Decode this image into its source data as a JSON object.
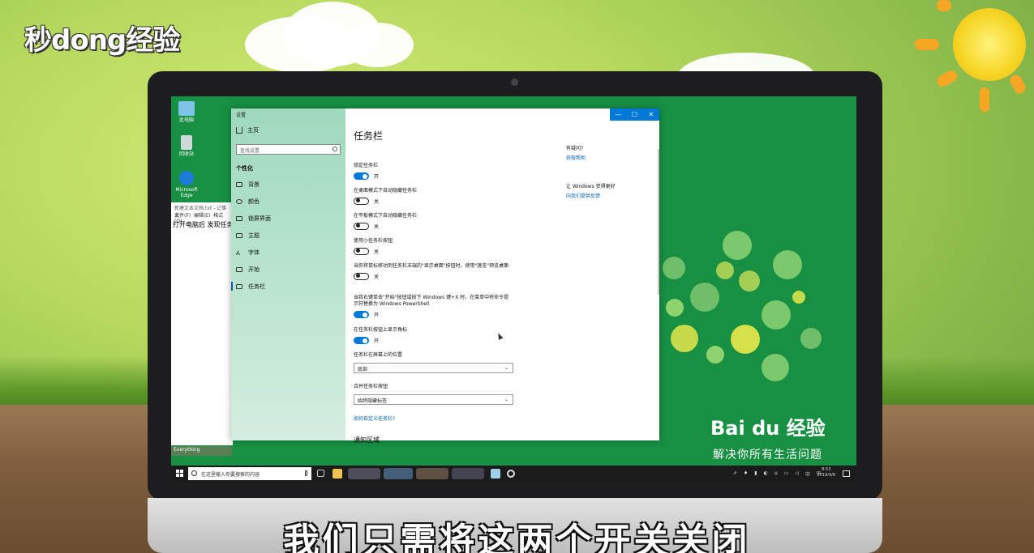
{
  "overlay": {
    "site_logo": "秒dong经验",
    "subtitle": "我们只需将这两个开关关闭"
  },
  "desktop": {
    "icons": [
      {
        "label": "此电脑",
        "icon": "computer-icon"
      },
      {
        "label": "回收站",
        "icon": "recycle-bin-icon"
      },
      {
        "label": "Microsoft Edge",
        "icon": "edge-icon"
      }
    ],
    "notepad": {
      "title": "新建文本文档.txt - 记事本",
      "menu": [
        "文件(F)",
        "编辑(E)",
        "格式(O)"
      ],
      "body": "打开电脑后 发现任务栏"
    },
    "everything_label": "Everything",
    "branding": {
      "logo": "Bai du 经验",
      "slogan": "解决你所有生活问题"
    }
  },
  "settings": {
    "window_title": "设置",
    "controls": {
      "minimize": "—",
      "maximize": "☐",
      "close": "✕"
    },
    "sidebar": {
      "home": "主页",
      "search_placeholder": "查找设置",
      "section": "个性化",
      "items": [
        {
          "label": "背景",
          "icon": "image-icon"
        },
        {
          "label": "颜色",
          "icon": "palette-icon"
        },
        {
          "label": "锁屏界面",
          "icon": "lock-screen-icon"
        },
        {
          "label": "主题",
          "icon": "theme-icon"
        },
        {
          "label": "字体",
          "icon": "font-icon"
        },
        {
          "label": "开始",
          "icon": "start-icon"
        },
        {
          "label": "任务栏",
          "icon": "taskbar-icon",
          "active": true
        }
      ]
    },
    "page_title": "任务栏",
    "toggles": [
      {
        "label": "锁定任务栏",
        "state": "开",
        "on": true
      },
      {
        "label": "在桌面模式下自动隐藏任务栏",
        "state": "关",
        "on": false
      },
      {
        "label": "在平板模式下自动隐藏任务栏",
        "state": "关",
        "on": false
      },
      {
        "label": "使用小任务栏按钮",
        "state": "关",
        "on": false
      },
      {
        "label": "当你将鼠标移动到任务栏末端的\"显示桌面\"按钮时，使用\"速览\"预览桌面",
        "state": "关",
        "on": false
      },
      {
        "label": "当我右键单击\"开始\"按钮或按下 Windows 键+X 时，在菜单中将命令提示符替换为 Windows PowerShell",
        "state": "开",
        "on": true
      },
      {
        "label": "在任务栏按钮上显示角标",
        "state": "开",
        "on": true
      }
    ],
    "position": {
      "label": "任务栏在屏幕上的位置",
      "value": "底部"
    },
    "combine": {
      "label": "合并任务栏按钮",
      "value": "始终隐藏标签"
    },
    "customize_link": "如何自定义任务栏?",
    "next_heading": "通知区域",
    "help": {
      "question": "有疑问?",
      "get_help": "获取帮助",
      "improve": "让 Windows 变得更好",
      "feedback": "向我们提供反馈"
    }
  },
  "taskbar": {
    "search_placeholder": "在这里输入你要搜索的内容",
    "tray_icons": [
      "⇗",
      "♦",
      "▮",
      "◐",
      "⌂",
      "▭",
      "◁",
      "中",
      "⊞"
    ],
    "time": "8:53",
    "date": "2019/9/8"
  },
  "colors": {
    "screen_green": "#179043",
    "accent": "#0078d7",
    "link": "#0063b1"
  }
}
